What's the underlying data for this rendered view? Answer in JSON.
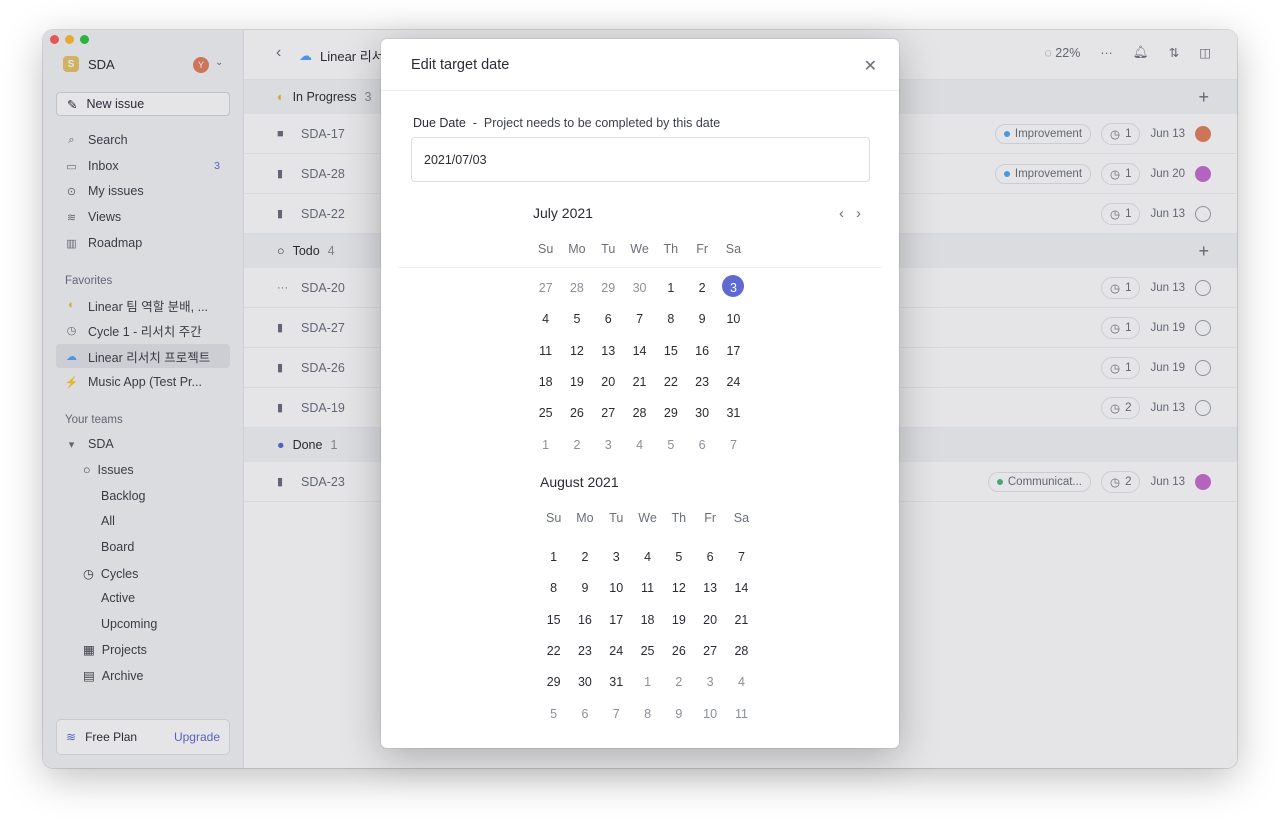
{
  "workspace": {
    "name": "SDA",
    "logo": "S",
    "avatar": "Y"
  },
  "sidebar": {
    "new_issue": "New issue",
    "nav": [
      {
        "label": "Search",
        "icon": "search-icon"
      },
      {
        "label": "Inbox",
        "icon": "inbox-icon",
        "badge": "3"
      },
      {
        "label": "My issues",
        "icon": "my-issues-icon"
      },
      {
        "label": "Views",
        "icon": "views-icon"
      },
      {
        "label": "Roadmap",
        "icon": "roadmap-icon"
      }
    ],
    "favorites_title": "Favorites",
    "favorites": [
      {
        "label": "Linear 팀 역할 분배, ..."
      },
      {
        "label": "Cycle 1 - 리서치 주간"
      },
      {
        "label": "Linear 리서치 프로젝트"
      },
      {
        "label": "Music App (Test Pr..."
      }
    ],
    "teams_title": "Your teams",
    "team": "SDA",
    "team_items": [
      "Issues",
      "Backlog",
      "All",
      "Board",
      "Cycles",
      "Active",
      "Upcoming",
      "Projects",
      "Archive"
    ],
    "plan": "Free Plan",
    "upgrade": "Upgrade"
  },
  "topbar": {
    "project": "Linear 리서",
    "progress": "22%"
  },
  "groups": [
    {
      "label": "In Progress",
      "count": "3"
    },
    {
      "label": "Todo",
      "count": "4"
    },
    {
      "label": "Done",
      "count": "1"
    }
  ],
  "rows": [
    {
      "id": "SDA-17",
      "label": "Improvement",
      "cycle": "1",
      "date": "Jun 13"
    },
    {
      "id": "SDA-28",
      "label": "Improvement",
      "cycle": "1",
      "date": "Jun 20"
    },
    {
      "id": "SDA-22",
      "label": "",
      "cycle": "1",
      "date": "Jun 13"
    },
    {
      "id": "SDA-20",
      "label": "",
      "cycle": "1",
      "date": "Jun 13"
    },
    {
      "id": "SDA-27",
      "label": "",
      "cycle": "1",
      "date": "Jun 19"
    },
    {
      "id": "SDA-26",
      "label": "",
      "cycle": "1",
      "date": "Jun 19"
    },
    {
      "id": "SDA-19",
      "label": "",
      "cycle": "2",
      "date": "Jun 13"
    },
    {
      "id": "SDA-23",
      "label": "Communicat...",
      "cycle": "2",
      "date": "Jun 13"
    }
  ],
  "modal": {
    "title": "Edit target date",
    "field_name": "Due Date",
    "field_sep": "-",
    "field_desc": "Project needs to be completed by this date",
    "value": "2021/07/03",
    "weekdays": [
      "Su",
      "Mo",
      "Tu",
      "We",
      "Th",
      "Fr",
      "Sa"
    ],
    "months": [
      {
        "title": "July 2021",
        "weeks": [
          [
            "27",
            "28",
            "29",
            "30",
            "1",
            "2",
            "3"
          ],
          [
            "4",
            "5",
            "6",
            "7",
            "8",
            "9",
            "10"
          ],
          [
            "11",
            "12",
            "13",
            "14",
            "15",
            "16",
            "17"
          ],
          [
            "18",
            "19",
            "20",
            "21",
            "22",
            "23",
            "24"
          ],
          [
            "25",
            "26",
            "27",
            "28",
            "29",
            "30",
            "31"
          ],
          [
            "1",
            "2",
            "3",
            "4",
            "5",
            "6",
            "7"
          ]
        ]
      },
      {
        "title": "August 2021",
        "weeks": [
          [
            "1",
            "2",
            "3",
            "4",
            "5",
            "6",
            "7"
          ],
          [
            "8",
            "9",
            "10",
            "11",
            "12",
            "13",
            "14"
          ],
          [
            "15",
            "16",
            "17",
            "18",
            "19",
            "20",
            "21"
          ],
          [
            "22",
            "23",
            "24",
            "25",
            "26",
            "27",
            "28"
          ],
          [
            "29",
            "30",
            "31",
            "1",
            "2",
            "3",
            "4"
          ],
          [
            "5",
            "6",
            "7",
            "8",
            "9",
            "10",
            "11"
          ]
        ]
      }
    ],
    "selected": "3",
    "accent": "#5e6ad2"
  }
}
